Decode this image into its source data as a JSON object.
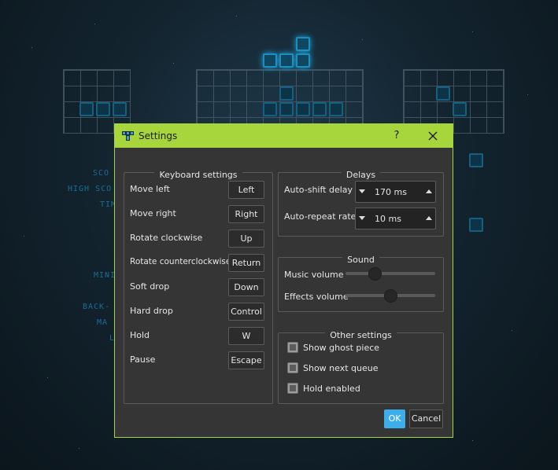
{
  "window": {
    "title": "Settings",
    "help_label": "?",
    "icon": "tetris-block-icon",
    "accent_color": "#a6d63c"
  },
  "keyboard": {
    "title": "Keyboard settings",
    "bindings": [
      {
        "action": "Move left",
        "key": "Left"
      },
      {
        "action": "Move right",
        "key": "Right"
      },
      {
        "action": "Rotate clockwise",
        "key": "Up"
      },
      {
        "action": "Rotate counterclockwise",
        "key": "Return"
      },
      {
        "action": "Soft drop",
        "key": "Down"
      },
      {
        "action": "Hard drop",
        "key": "Control"
      },
      {
        "action": "Hold",
        "key": "W"
      },
      {
        "action": "Pause",
        "key": "Escape"
      }
    ]
  },
  "delays": {
    "title": "Delays",
    "auto_shift": {
      "label": "Auto-shift delay",
      "value": "170 ms"
    },
    "auto_repeat": {
      "label": "Auto-repeat rate",
      "value": "10 ms"
    }
  },
  "sound": {
    "title": "Sound",
    "music": {
      "label": "Music volume",
      "level": 0.3
    },
    "effects": {
      "label": "Effects volume",
      "level": 0.5
    }
  },
  "other": {
    "title": "Other settings",
    "options": [
      {
        "label": "Show ghost piece",
        "checked": false
      },
      {
        "label": "Show next queue",
        "checked": false
      },
      {
        "label": "Hold enabled",
        "checked": false
      }
    ]
  },
  "buttons": {
    "ok": "OK",
    "cancel": "Cancel",
    "ok_color": "#3daee9"
  },
  "background": {
    "labels": [
      "SCO",
      "HIGH SCO",
      "TIM",
      "MINI",
      "BACK-",
      "MA",
      "L"
    ]
  }
}
